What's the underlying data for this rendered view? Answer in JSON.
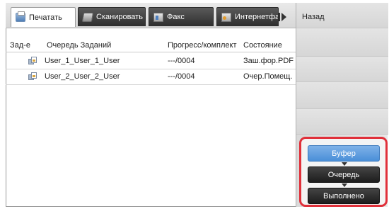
{
  "tabs": [
    {
      "label": "Печатать",
      "icon": "print-icon",
      "active": true
    },
    {
      "label": "Сканировать",
      "icon": "scan-icon",
      "active": false
    },
    {
      "label": "Факс",
      "icon": "fax-icon",
      "active": false
    },
    {
      "label": "Интернетфакс",
      "icon": "internet-fax-icon",
      "active": false
    }
  ],
  "back_label": "Назад",
  "columns": {
    "job": "Зад-е",
    "queue": "Очередь Заданий",
    "progress": "Прогресс/комплект",
    "status": "Состояние"
  },
  "rows": [
    {
      "name": "User_1_User_1_User",
      "progress": "---/0004",
      "status": "Заш.фор.PDF"
    },
    {
      "name": "User_2_User_2_User",
      "progress": "---/0004",
      "status": "Очер.Помещ."
    }
  ],
  "buttons": {
    "buffer": "Буфер",
    "queue": "Очередь",
    "done": "Выполнено"
  },
  "colors": {
    "highlight_border": "#e0303a",
    "buffer_button": "#4a8fd8",
    "dark_button": "#1d1d1d"
  }
}
